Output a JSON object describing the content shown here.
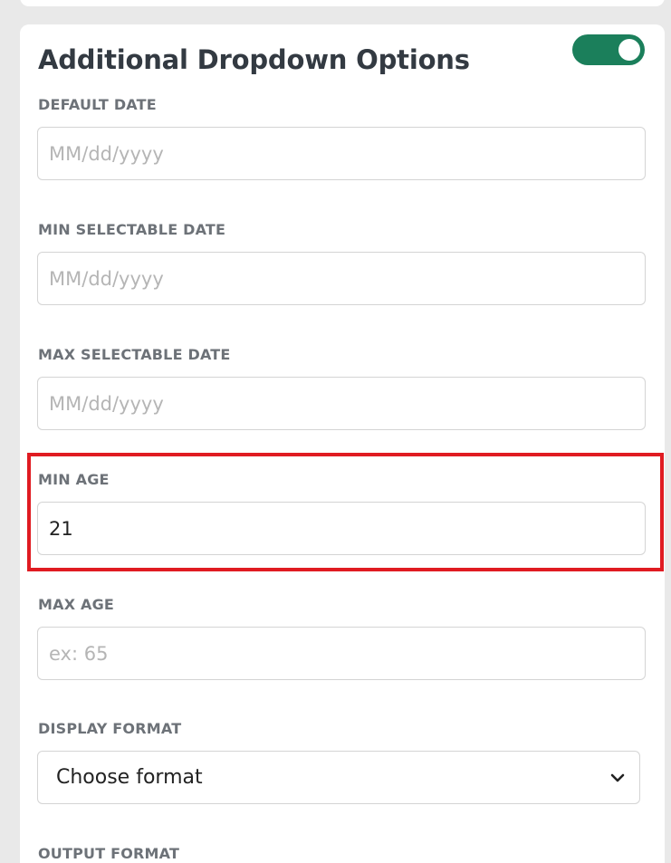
{
  "panel": {
    "title": "Additional Dropdown Options",
    "toggle_state": "on",
    "accent_color": "#1b7f5b",
    "highlight_color": "#e01b22"
  },
  "fields": {
    "default_date": {
      "label": "DEFAULT DATE",
      "value": "",
      "placeholder": "MM/dd/yyyy"
    },
    "min_selectable_date": {
      "label": "MIN SELECTABLE DATE",
      "value": "",
      "placeholder": "MM/dd/yyyy"
    },
    "max_selectable_date": {
      "label": "MAX SELECTABLE DATE",
      "value": "",
      "placeholder": "MM/dd/yyyy"
    },
    "min_age": {
      "label": "MIN AGE",
      "value": "21",
      "placeholder": ""
    },
    "max_age": {
      "label": "MAX AGE",
      "value": "",
      "placeholder": "ex: 65"
    },
    "display_format": {
      "label": "DISPLAY FORMAT",
      "selected": "Choose format",
      "icon": "chevron-down-icon"
    },
    "output_format": {
      "label": "OUTPUT FORMAT"
    }
  }
}
